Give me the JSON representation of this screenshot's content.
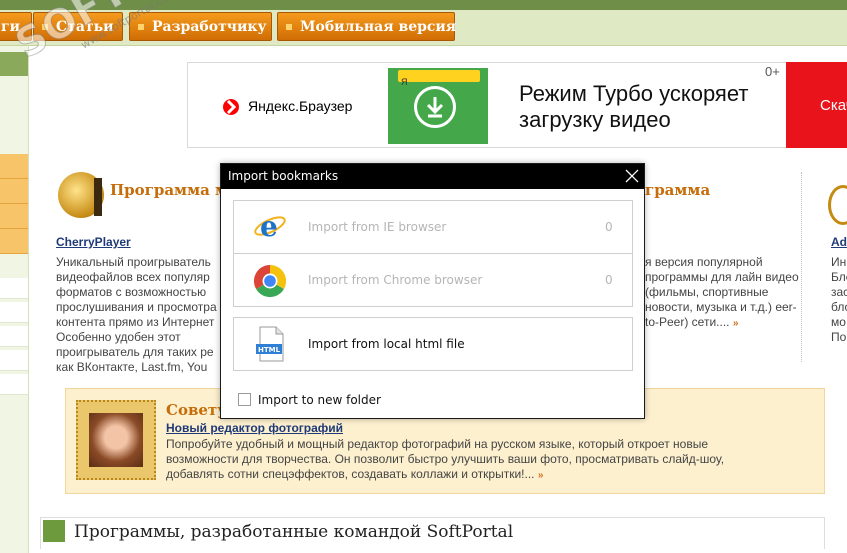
{
  "site": {
    "nav": [
      {
        "label": "ги"
      },
      {
        "label": "Статьи"
      },
      {
        "label": "Разработчику"
      },
      {
        "label": "Мобильная версия"
      }
    ],
    "watermark": {
      "big": "SOFTPORTAL",
      "small": "www.softportal.com"
    }
  },
  "ad": {
    "brand": "Яндекс.Браузер",
    "headline_line1": "Режим Турбо ускоряет",
    "headline_line2": "загрузку видео",
    "age": "0+",
    "cta": "Скачать",
    "tab_letter": "Я"
  },
  "programs": [
    {
      "section_title": "Программа ме",
      "name": "CherryPlayer",
      "description": "Уникальный проигрыватель видеофайлов всех популяр форматов с возможностью прослушивания и просмотра контента прямо из Интернет Особенно удобен этот проигрыватель для таких ре как ВКонтакте, Last.fm, You BBC, BillBoard...",
      "more": "»"
    },
    {
      "section_title": "граммa",
      "description": "я версия популярной программы для лайн видео (фильмы, спортивные новости, музыка и т.д.) eer-to-Peer) сети....",
      "more": "»"
    },
    {
      "name": "Ad",
      "description": "Ин Бле зас бло мо По"
    }
  ],
  "advice": {
    "title": "Советуе",
    "link": "Новый редактор фотографий",
    "description": "Попробуйте удобный и мощный редактор фотографий на русском языке, который откроет новые возможности для творчества. Он позволит быстро улучшить ваши фото, просматривать слайд-шоу, добавлять сотни спецэффектов, создавать коллажи и открытки!...",
    "more": "»"
  },
  "bottom_heading": "Программы, разработанные командой SoftPortal",
  "dialog": {
    "title": "Import bookmarks",
    "close_icon": "close-icon",
    "options": [
      {
        "label": "Import from IE browser",
        "count": "0",
        "enabled": false,
        "icon": "ie-icon"
      },
      {
        "label": "Import from Chrome browser",
        "count": "0",
        "enabled": false,
        "icon": "chrome-icon"
      },
      {
        "label": "Import from local html file",
        "enabled": true,
        "icon": "html-file-icon",
        "icon_text": "HTML"
      }
    ],
    "new_folder_checkbox": {
      "label": "Import to new folder",
      "checked": false
    }
  },
  "colors": {
    "nav_orange": "#e8850f",
    "site_green": "#6f8e47",
    "ad_red": "#e8131b",
    "ad_green": "#44a84a",
    "dialog_titlebar": "#000000"
  }
}
